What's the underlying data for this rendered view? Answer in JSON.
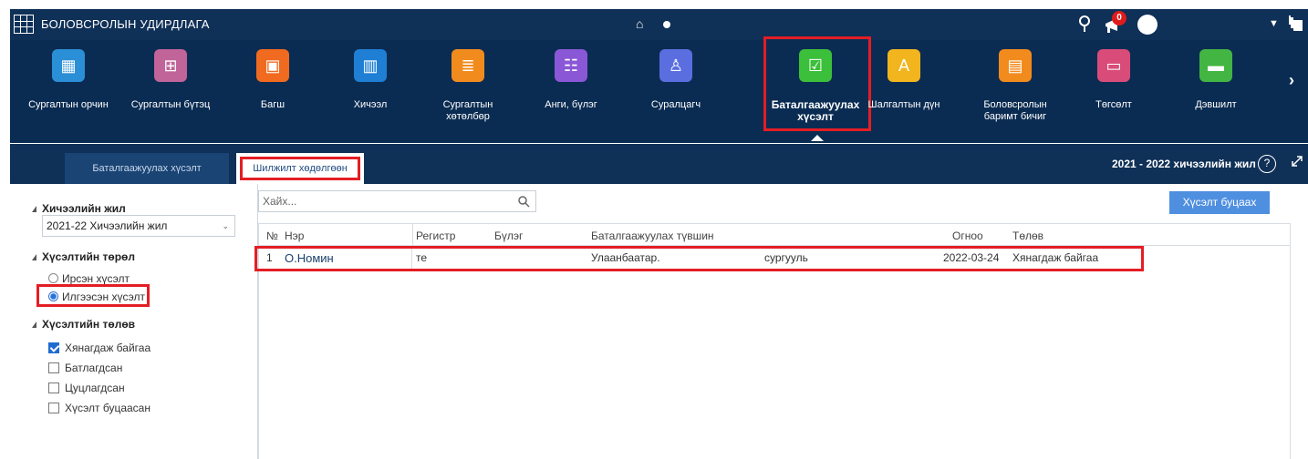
{
  "topbar": {
    "title": "БОЛОВСРОЛЫН УДИРДЛАГА",
    "notification_count": "0"
  },
  "modules": [
    {
      "label": "Сургалтын орчин",
      "icon": "building-icon",
      "color": "#2a8fd6"
    },
    {
      "label": "Сургалтын бүтэц",
      "icon": "org-chart-icon",
      "color": "#c0649a"
    },
    {
      "label": "Багш",
      "icon": "teacher-icon",
      "color": "#f06a1f"
    },
    {
      "label": "Хичээл",
      "icon": "book-icon",
      "color": "#1e7fd4"
    },
    {
      "label": "Сургалтын хөтөлбөр",
      "icon": "books-icon",
      "color": "#f28b1e"
    },
    {
      "label": "Анги, бүлэг",
      "icon": "group-icon",
      "color": "#8a57d6"
    },
    {
      "label": "Суралцагч",
      "icon": "student-icon",
      "color": "#5b6ee0"
    },
    {
      "label": "Баталгаажуулах хүсэлт",
      "icon": "approve-icon",
      "color": "#3cbf3a"
    },
    {
      "label": "Шалгалтын дүн",
      "icon": "grade-icon",
      "color": "#f2b51e"
    },
    {
      "label": "Боловсролын баримт бичиг",
      "icon": "document-icon",
      "color": "#f28b1e"
    },
    {
      "label": "Төгсөлт",
      "icon": "graduation-icon",
      "color": "#d94c7a"
    },
    {
      "label": "Дэвшилт",
      "icon": "promotion-icon",
      "color": "#43b543"
    }
  ],
  "tabs": {
    "tab1": "Баталгаажуулах хүсэлт",
    "tab2": "Шилжилт хөдөлгөөн"
  },
  "year_label": "2021 - 2022 хичээлийн жил",
  "sidebar": {
    "year_title": "Хичээлийн жил",
    "year_value": "2021-22 Хичээлийн жил",
    "type_title": "Хүсэлтийн төрөл",
    "type_options": [
      "Ирсэн хүсэлт",
      "Илгээсэн хүсэлт"
    ],
    "status_title": "Хүсэлтийн төлөв",
    "status_options": [
      "Хянагдаж байгаа",
      "Батлагдсан",
      "Цуцлагдсан",
      "Хүсэлт буцаасан"
    ]
  },
  "search": {
    "placeholder": "Хайх..."
  },
  "cancel_button": "Хүсэлт буцаах",
  "table": {
    "headers": [
      "№",
      "Нэр",
      "Регистр",
      "Бүлэг",
      "Баталгаажуулах түвшин",
      "Огноо",
      "Төлөв"
    ],
    "rows": [
      {
        "no": "1",
        "name": "О.Номин",
        "register": "те",
        "group": "",
        "level": "Улаанбаатар.",
        "level2": "сургууль",
        "date": "2022-03-24",
        "status": "Хянагдаж байгаа"
      }
    ]
  }
}
